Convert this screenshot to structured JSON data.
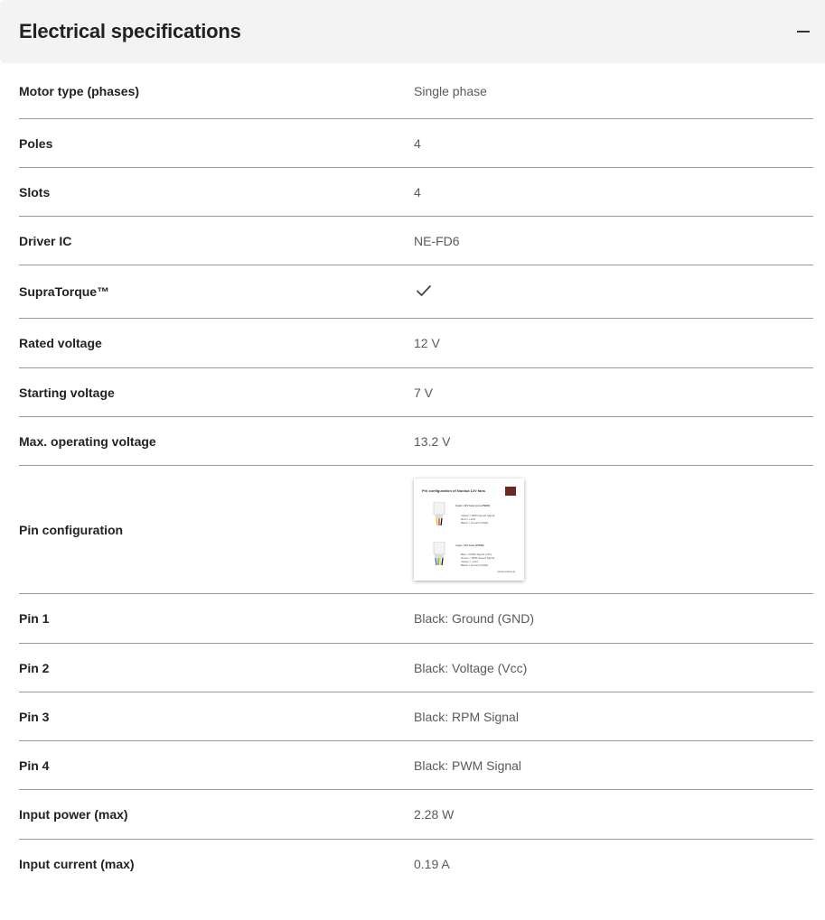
{
  "section": {
    "title": "Electrical specifications"
  },
  "specs": [
    {
      "label": "Motor type (phases)",
      "value": "Single phase"
    },
    {
      "label": "Poles",
      "value": "4"
    },
    {
      "label": "Slots",
      "value": "4"
    },
    {
      "label": "Driver IC",
      "value": "NE-FD6"
    },
    {
      "label": "SupraTorque™",
      "value": "",
      "icon": "checkmark-icon"
    },
    {
      "label": "Rated voltage",
      "value": "12 V"
    },
    {
      "label": "Starting voltage",
      "value": "7 V"
    },
    {
      "label": "Max. operating voltage",
      "value": "13.2 V"
    },
    {
      "label": "Pin configuration",
      "value": "",
      "icon": "pin-configuration-diagram-thumbnail"
    },
    {
      "label": "Pin 1",
      "value": "Black: Ground (GND)"
    },
    {
      "label": "Pin 2",
      "value": "Black: Voltage (Vcc)"
    },
    {
      "label": "Pin 3",
      "value": "Black: RPM Signal"
    },
    {
      "label": "Pin 4",
      "value": "Black: PWM Signal"
    },
    {
      "label": "Input power (max)",
      "value": "2.28 W"
    },
    {
      "label": "Input current (max)",
      "value": "0.19 A"
    }
  ],
  "thumbnail": {
    "title": "Pin configuration of Noctua 12V fans",
    "block1_title": "3-pin: 12V fans (non-PWM)",
    "block1_lines": [
      "Yellow = RPM Speed Signal",
      "Red = +12V",
      "Black = Ground (GND)"
    ],
    "block2_title": "4-pin: 12V fans (PWM)",
    "block2_lines": [
      "Blue = PWM Signal (+5V)",
      "Green = RPM Speed Signal",
      "Yellow = +12V",
      "Black = Ground (GND)"
    ],
    "footer": "www.noctua.at"
  },
  "colors": {
    "header_bg": "#f3f3f3",
    "divider": "#9a9a9a",
    "label_text": "#222222",
    "value_text": "#5a5a5a"
  }
}
